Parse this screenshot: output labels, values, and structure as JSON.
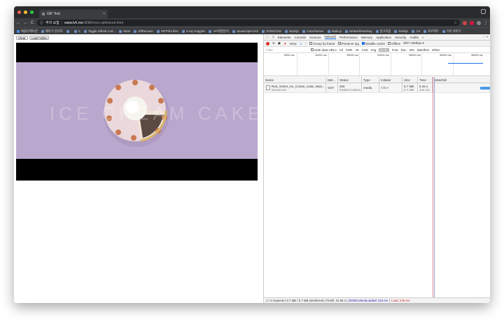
{
  "window": {
    "tab_title": "GIF Test",
    "tab_close": "×"
  },
  "toolbar": {
    "back": "←",
    "forward": "→",
    "reload": "C",
    "security_label": "주의 요함",
    "host": "www.lvh.me",
    "path": ":8080/mov-optimized.html",
    "star": "☆"
  },
  "bookmarks": [
    "애플리케이션",
    "페이크 관리자",
    "",
    "C",
    "Toggle Github Cod...",
    "clean",
    "GifRemove",
    "GIFPrint this!",
    "X-ray Goggles",
    "API개발문서",
    "Javascript/AJAX",
    "HTML/CSS",
    "MySQL",
    "Linux/Server",
    "Node.js",
    "Network/Hacking",
    "알고리즘",
    "NoSQL",
    "C#",
    "프로젝트",
    "기타 북마크"
  ],
  "page": {
    "clear_label": "Clear",
    "load_label": "Load Video",
    "watermark": "ICE CREAM CAKE"
  },
  "devtools": {
    "tabs": [
      "Elements",
      "Console",
      "Sources",
      "Network",
      "Performance",
      "Memory",
      "Application",
      "Security",
      "Audits",
      "»"
    ],
    "active_tab": "Network",
    "controls": {
      "view_label": "View:",
      "group_by_frame": "Group by frame",
      "preserve_log": "Preserve log",
      "disable_cache": "Disable cache",
      "offline": "Offline",
      "throttle": "WiFi 10Mbps"
    },
    "filter": {
      "placeholder": "Filter",
      "hide_data_urls": "Hide data URLs",
      "types": [
        "All",
        "XHR",
        "JS",
        "CSS",
        "Img",
        "Media",
        "Font",
        "Doc",
        "WS",
        "Manifest",
        "Other"
      ],
      "selected_type": "Media"
    },
    "overview_ticks": [
      "5000 ms",
      "10000 ms",
      "15000 ms",
      "20000 ms",
      "25000 ms",
      "30000 ms",
      "35000 ms"
    ],
    "columns": [
      "Name",
      "Met...",
      "Status",
      "Type",
      "Initiator",
      "Size",
      "Time",
      "Waterfall"
    ],
    "rows": [
      {
        "name": "Red_Velvet_Ice_Cream_Cake_Musi...",
        "name_sub": "/resources",
        "method": "GET",
        "status": "206",
        "status_sub": "Partial Content",
        "type": "media",
        "initiator": "Other",
        "size": "6.7 MB",
        "size_sub": "6.7 MB",
        "time": "5.45 s",
        "time_sub": "104 ms"
      }
    ],
    "status_bar": {
      "summary": "1 / 4 requests | 6.7 MB / 6.7 MB transferred | Finish: 31.55 s |",
      "dom_loaded": "DOMContentLoaded: 243 ms",
      "sep": "|",
      "load": "Load: 246 ms"
    }
  },
  "colors": {
    "accent": "#1a73e8",
    "record": "#d93025",
    "video_bg": "#b9a6cc"
  }
}
